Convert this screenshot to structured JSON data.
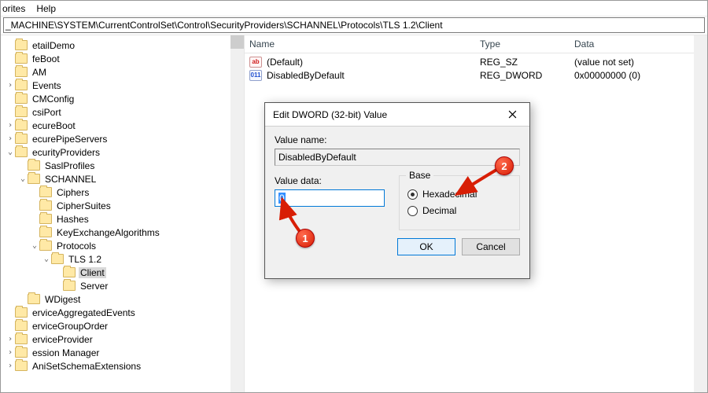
{
  "menubar": {
    "item1": "orites",
    "item2": "Help"
  },
  "address": "_MACHINE\\SYSTEM\\CurrentControlSet\\Control\\SecurityProviders\\SCHANNEL\\Protocols\\TLS 1.2\\Client",
  "tree": [
    {
      "label": "etailDemo",
      "indent": 6,
      "tw": ""
    },
    {
      "label": "feBoot",
      "indent": 6,
      "tw": ""
    },
    {
      "label": "AM",
      "indent": 6,
      "tw": ""
    },
    {
      "label": "Events",
      "indent": 6,
      "tw": ">"
    },
    {
      "label": "CMConfig",
      "indent": 6,
      "tw": ""
    },
    {
      "label": "csiPort",
      "indent": 6,
      "tw": ""
    },
    {
      "label": "ecureBoot",
      "indent": 6,
      "tw": ">"
    },
    {
      "label": "ecurePipeServers",
      "indent": 6,
      "tw": ">"
    },
    {
      "label": "ecurityProviders",
      "indent": 6,
      "tw": "v"
    },
    {
      "label": "SaslProfiles",
      "indent": 22,
      "tw": ""
    },
    {
      "label": "SCHANNEL",
      "indent": 22,
      "tw": "v"
    },
    {
      "label": "Ciphers",
      "indent": 37,
      "tw": ""
    },
    {
      "label": "CipherSuites",
      "indent": 37,
      "tw": ""
    },
    {
      "label": "Hashes",
      "indent": 37,
      "tw": ""
    },
    {
      "label": "KeyExchangeAlgorithms",
      "indent": 37,
      "tw": ""
    },
    {
      "label": "Protocols",
      "indent": 37,
      "tw": "v"
    },
    {
      "label": "TLS 1.2",
      "indent": 52,
      "tw": "v"
    },
    {
      "label": "Client",
      "indent": 67,
      "tw": "",
      "selected": true
    },
    {
      "label": "Server",
      "indent": 67,
      "tw": ""
    },
    {
      "label": "WDigest",
      "indent": 22,
      "tw": ""
    },
    {
      "label": "erviceAggregatedEvents",
      "indent": 6,
      "tw": ""
    },
    {
      "label": "erviceGroupOrder",
      "indent": 6,
      "tw": ""
    },
    {
      "label": "erviceProvider",
      "indent": 6,
      "tw": ">"
    },
    {
      "label": "ession Manager",
      "indent": 6,
      "tw": ">"
    },
    {
      "label": "AniSetSchemaExtensions",
      "indent": 6,
      "tw": ">"
    }
  ],
  "listhead": {
    "name": "Name",
    "type": "Type",
    "data": "Data"
  },
  "rows": [
    {
      "icon": "ab",
      "name": "(Default)",
      "type": "REG_SZ",
      "data": "(value not set)"
    },
    {
      "icon": "01",
      "name": "DisabledByDefault",
      "type": "REG_DWORD",
      "data": "0x00000000 (0)"
    }
  ],
  "dialog": {
    "title": "Edit DWORD (32-bit) Value",
    "valueNameLabel": "Value name:",
    "valueName": "DisabledByDefault",
    "valueDataLabel": "Value data:",
    "valueData": "0",
    "baseLegend": "Base",
    "hexLabel": "Hexadecimal",
    "decLabel": "Decimal",
    "ok": "OK",
    "cancel": "Cancel"
  },
  "annotations": {
    "a1": "1",
    "a2": "2"
  }
}
